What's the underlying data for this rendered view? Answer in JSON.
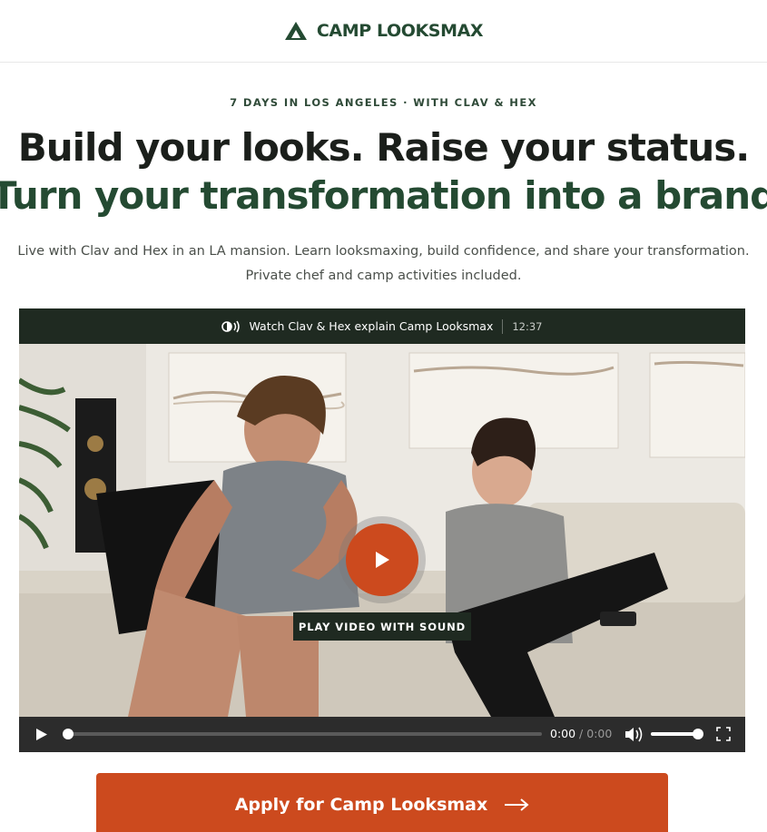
{
  "header": {
    "brand_name": "CAMP LOOKSMAX",
    "logo_icon": "triangle-tent-icon"
  },
  "hero": {
    "kicker": "7 DAYS IN LOS ANGELES · WITH CLAV & HEX",
    "headline_line1": "Build your looks. Raise your status.",
    "headline_line2": "Turn your transformation into a brand",
    "subtext_line1": "Live with Clav and Hex in an LA mansion. Learn looksmaxing, build confidence, and share your transformation.",
    "subtext_line2": "Private chef and camp activities included."
  },
  "video": {
    "title": "Watch Clav & Hex explain Camp Looksmax",
    "duration": "12:37",
    "overlay_label": "PLAY VIDEO WITH SOUND",
    "current_time": "0:00",
    "time_separator": " / ",
    "total_time": "0:00",
    "progress": 0,
    "volume": 1.0
  },
  "cta": {
    "label": "Apply for Camp Looksmax"
  },
  "colors": {
    "brand_green": "#244a32",
    "accent_orange": "#cc4a1e",
    "dark_bar": "#1f2a21"
  }
}
